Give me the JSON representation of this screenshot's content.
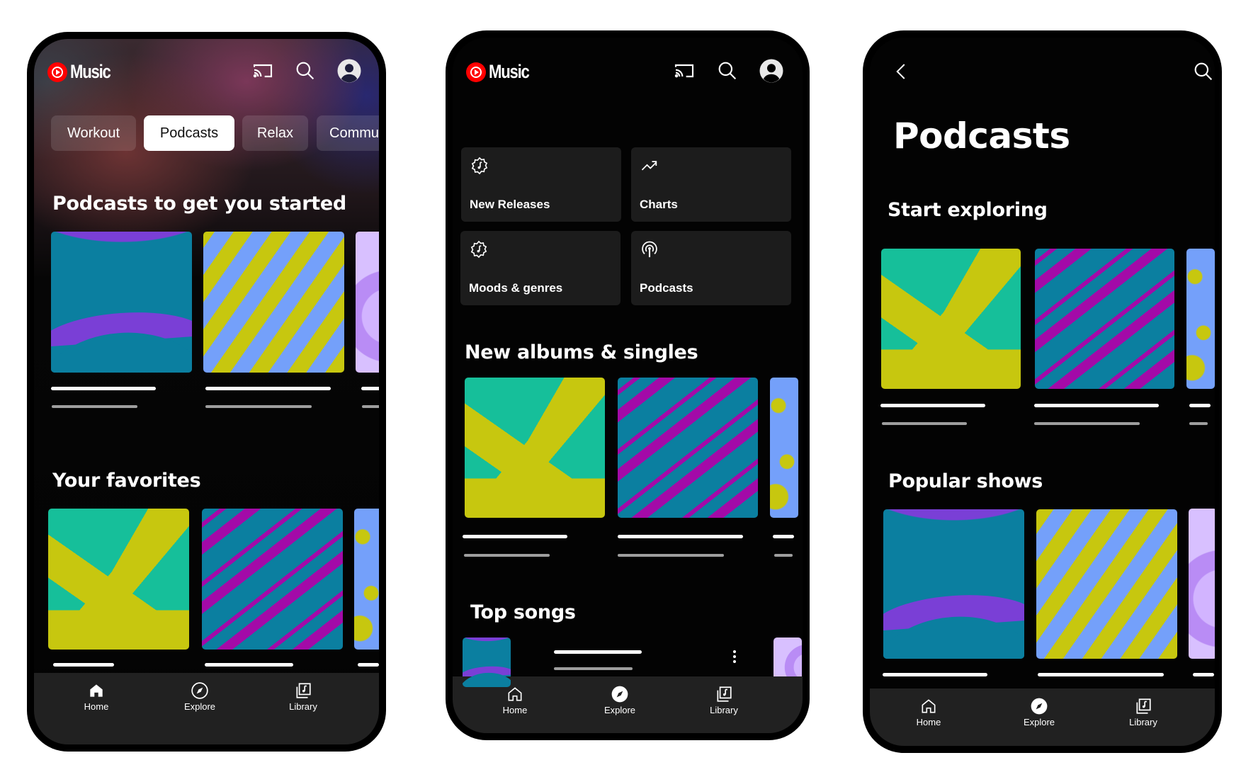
{
  "brand": {
    "name": "Music",
    "accent": "#ff0000"
  },
  "colors": {
    "screen_bg": "#030303",
    "tile_bg": "#1c1c1c",
    "nav_bg": "#212121",
    "chip_active_bg": "#ffffff"
  },
  "phones": [
    {
      "screen": "home",
      "header": {
        "logo_text": "Music",
        "icons": [
          "cast-icon",
          "search-icon",
          "account-avatar"
        ]
      },
      "chips": [
        {
          "label": "Workout",
          "active": false
        },
        {
          "label": "Podcasts",
          "active": true
        },
        {
          "label": "Relax",
          "active": false
        },
        {
          "label": "Commu",
          "active": false
        }
      ],
      "sections": [
        {
          "title": "Podcasts to get you started",
          "items": 3
        },
        {
          "title": "Your favorites",
          "items": 3
        }
      ],
      "nav": {
        "items": [
          {
            "label": "Home",
            "active": true
          },
          {
            "label": "Explore",
            "active": false
          },
          {
            "label": "Library",
            "active": false
          }
        ]
      }
    },
    {
      "screen": "explore",
      "header": {
        "logo_text": "Music",
        "icons": [
          "cast-icon",
          "search-icon",
          "account-avatar"
        ]
      },
      "tiles": [
        {
          "label": "New Releases",
          "icon": "new-releases-icon"
        },
        {
          "label": "Charts",
          "icon": "trending-icon"
        },
        {
          "label": "Moods & genres",
          "icon": "moods-icon"
        },
        {
          "label": "Podcasts",
          "icon": "podcast-icon"
        }
      ],
      "sections": [
        {
          "title": "New albums & singles",
          "items": 3
        },
        {
          "title": "Top songs",
          "items": 1
        }
      ],
      "nav": {
        "items": [
          {
            "label": "Home",
            "active": false
          },
          {
            "label": "Explore",
            "active": true
          },
          {
            "label": "Library",
            "active": false
          }
        ]
      }
    },
    {
      "screen": "podcasts",
      "header": {
        "icons": [
          "back-icon",
          "search-icon"
        ]
      },
      "page_title": "Podcasts",
      "sections": [
        {
          "title": "Start exploring",
          "items": 3
        },
        {
          "title": "Popular shows",
          "items": 3
        }
      ],
      "nav": {
        "items": [
          {
            "label": "Home",
            "active": false
          },
          {
            "label": "Explore",
            "active": true
          },
          {
            "label": "Library",
            "active": false
          }
        ]
      }
    }
  ]
}
